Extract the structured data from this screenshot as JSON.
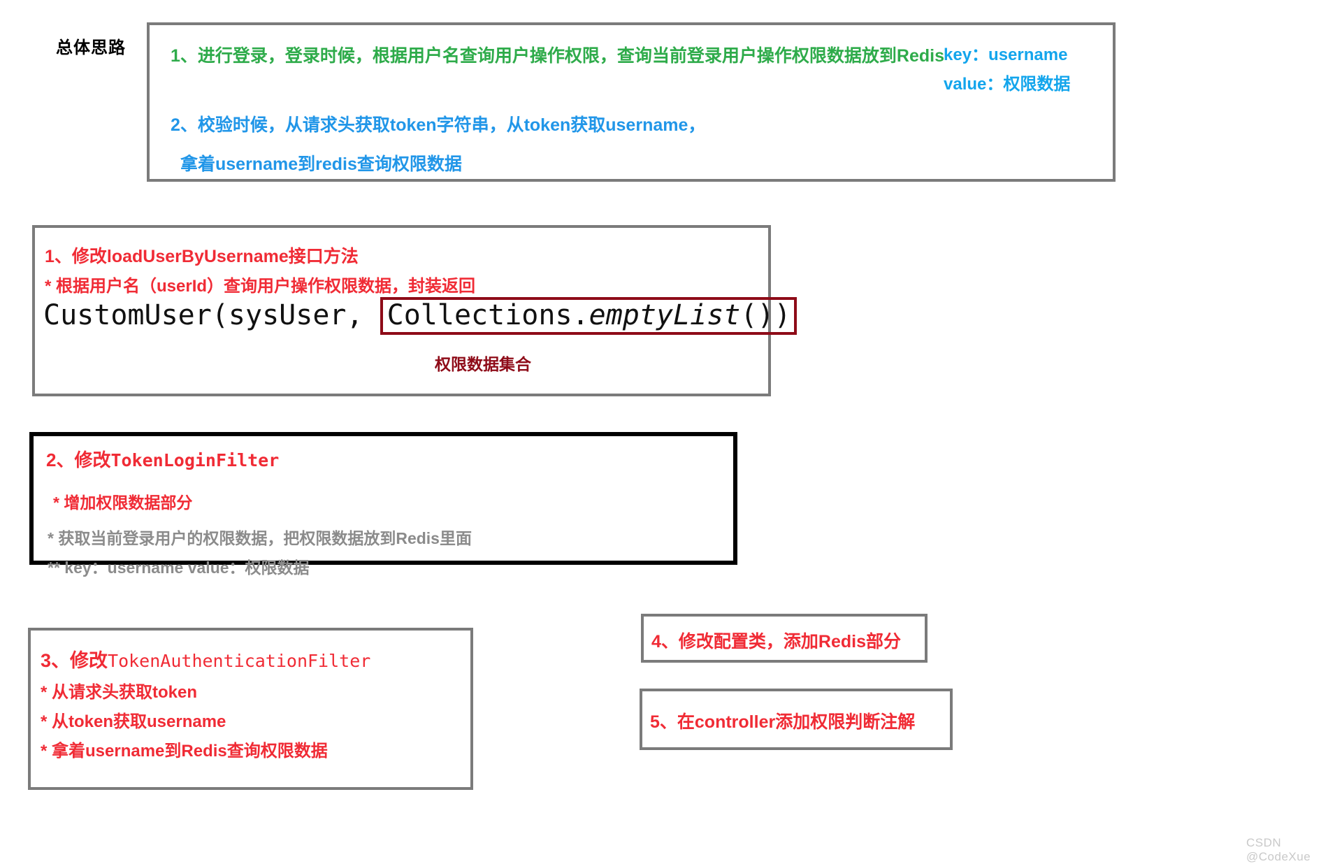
{
  "page": {
    "heading_label": "总体思路",
    "watermark": "CSDN @CodeXue"
  },
  "overview_box": {
    "line1": "1、进行登录，登录时候，根据用户名查询用户操作权限，查询当前登录用户操作权限数据放到Redis",
    "line2": "2、校验时候，从请求头获取token字符串，从token获取username，",
    "line3": "拿着username到redis查询权限数据",
    "note_key": "key：username",
    "note_value": "value：权限数据"
  },
  "step1_box": {
    "title": "1、修改loadUserByUsername接口方法",
    "subtitle": "* 根据用户名（userId）查询用户操作权限数据，封装返回",
    "code_prefix": "CustomUser(sysUser, ",
    "code_highlight_a": "Collections.",
    "code_highlight_b": "emptyList",
    "code_highlight_c": "())",
    "caption": "权限数据集合"
  },
  "step2_box": {
    "title_prefix": "2、修改",
    "title_class": "TokenLoginFilter",
    "line1": "* 增加权限数据部分",
    "line2": "* 获取当前登录用户的权限数据，把权限数据放到Redis里面",
    "line3": "** key：username   value：权限数据"
  },
  "step3_box": {
    "title_prefix": "3、修改",
    "title_class": "TokenAuthenticationFilter",
    "line1": "* 从请求头获取token",
    "line2": "* 从token获取username",
    "line3": "* 拿着username到Redis查询权限数据"
  },
  "step4_box": {
    "title": "4、修改配置类，添加Redis部分"
  },
  "step5_box": {
    "title": "5、在controller添加权限判断注解"
  },
  "colors": {
    "green": "#2eab4a",
    "blue": "#2196e8",
    "cyan": "#13a5ec",
    "red": "#f02b35",
    "dark_red": "#8e0b18",
    "gray_border": "#7b7b7b",
    "gray_text": "#8b8b8b",
    "black_border": "#000000"
  }
}
